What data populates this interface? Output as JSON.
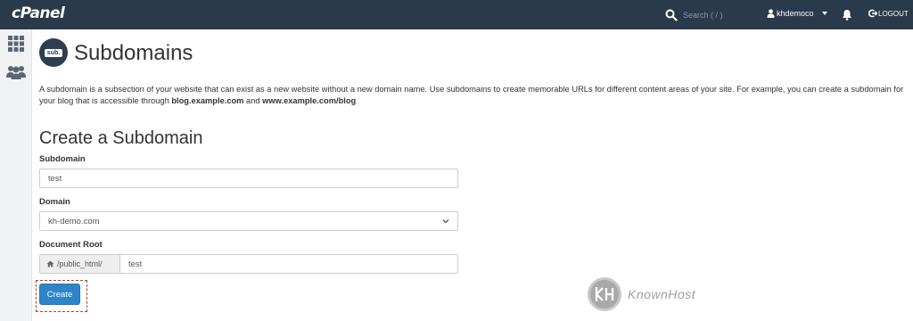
{
  "header": {
    "logo": "cPanel",
    "search_placeholder": "Search ( / )",
    "username": "khdemoco",
    "logout_label": "LOGOUT"
  },
  "sidebar": {
    "items": [
      {
        "icon": "grid-icon",
        "name": "home"
      },
      {
        "icon": "users-icon",
        "name": "user-manager"
      }
    ]
  },
  "page": {
    "icon_text": "sub.",
    "title": "Subdomains",
    "description_part1": "A subdomain is a subsection of your website that can exist as a new website without a new domain name. Use subdomains to create memorable URLs for different content areas of your site. For example, you can create a subdomain for your blog that is accessible through ",
    "description_link1": "blog.example.com",
    "description_part2": " and ",
    "description_link2": "www.example.com/blog"
  },
  "form": {
    "section_title": "Create a Subdomain",
    "subdomain_label": "Subdomain",
    "subdomain_value": "test",
    "domain_label": "Domain",
    "domain_value": "kh-demo.com",
    "docroot_label": "Document Root",
    "docroot_prefix": "/public_html/",
    "docroot_value": "test",
    "create_label": "Create"
  },
  "watermark": {
    "text": "KnownHost"
  },
  "colors": {
    "topbar": "#293a4a",
    "primary_button": "#2e84c8",
    "highlight": "#c0392b"
  }
}
